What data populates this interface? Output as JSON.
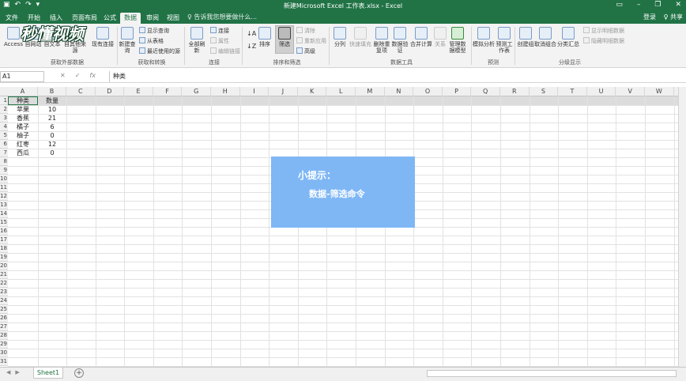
{
  "window": {
    "title": "新建Microsoft Excel 工作表.xlsx - Excel",
    "qat_icons": [
      "save-icon",
      "undo-icon",
      "redo-icon",
      "customize-icon"
    ],
    "controls": [
      "ribbon-options-icon",
      "minimize-icon",
      "restore-icon",
      "close-icon"
    ]
  },
  "tabs": [
    "文件",
    "开始",
    "插入",
    "页面布局",
    "公式",
    "数据",
    "审阅",
    "视图"
  ],
  "active_tab": "数据",
  "tell_me": "♀ 告诉我您想要做什么...",
  "account": {
    "login": "登录",
    "share": "♀ 共享"
  },
  "watermark": "秒懂视频",
  "ribbon": {
    "get_external": {
      "access": "Access",
      "web": "自网站",
      "text": "自文本",
      "other": "自其他来源",
      "existing": "现有连接",
      "label": "获取外部数据"
    },
    "transform": {
      "new_query": "新建查询",
      "show_queries": "显示查询",
      "from_table": "从表格",
      "recent": "最近使用的源",
      "label": "获取和转换"
    },
    "connections": {
      "refresh_all": "全部刷新",
      "connections": "连接",
      "properties": "属性",
      "edit_links": "编辑链接",
      "label": "连接"
    },
    "sort_filter": {
      "sort": "排序",
      "filter": "筛选",
      "clear": "清除",
      "reapply": "重新应用",
      "advanced": "高级",
      "label": "排序和筛选"
    },
    "data_tools": {
      "split": "分列",
      "flash": "快速填充",
      "remove_dup": "删除重复项",
      "validation": "数据验证",
      "consolidate": "合并计算",
      "relations": "关系",
      "manage_model": "管理数据模型",
      "label": "数据工具"
    },
    "forecast": {
      "what_if": "模拟分析",
      "forecast_sheet": "预测工作表",
      "label": "预测"
    },
    "outline": {
      "group": "创建组",
      "ungroup": "取消组合",
      "subtotal": "分类汇总",
      "show_detail": "显示明细数据",
      "hide_detail": "隐藏明细数据",
      "label": "分级显示"
    }
  },
  "formula_bar": {
    "name_box": "A1",
    "fx": "fx",
    "value": "种类"
  },
  "columns": [
    "A",
    "B",
    "C",
    "D",
    "E",
    "F",
    "G",
    "H",
    "I",
    "J",
    "K",
    "L",
    "M",
    "N",
    "O",
    "P",
    "Q",
    "R",
    "S",
    "T",
    "U",
    "V",
    "W"
  ],
  "rows": [
    "1",
    "2",
    "3",
    "4",
    "5",
    "6",
    "7",
    "8",
    "9",
    "10",
    "11",
    "12",
    "13",
    "14",
    "15",
    "16",
    "17",
    "18",
    "19",
    "20",
    "21",
    "22",
    "23",
    "24",
    "25",
    "26",
    "27",
    "28",
    "29",
    "30",
    "31"
  ],
  "table": {
    "headers": [
      "种类",
      "数量"
    ],
    "data": [
      [
        "苹果",
        "10"
      ],
      [
        "香蕉",
        "21"
      ],
      [
        "橘子",
        "6"
      ],
      [
        "柚子",
        "0"
      ],
      [
        "红枣",
        "12"
      ],
      [
        "西瓜",
        "0"
      ]
    ]
  },
  "sheet": {
    "name": "Sheet1",
    "add": "+"
  },
  "tip": {
    "title": "小提示：",
    "body": "数据-筛选命令"
  }
}
